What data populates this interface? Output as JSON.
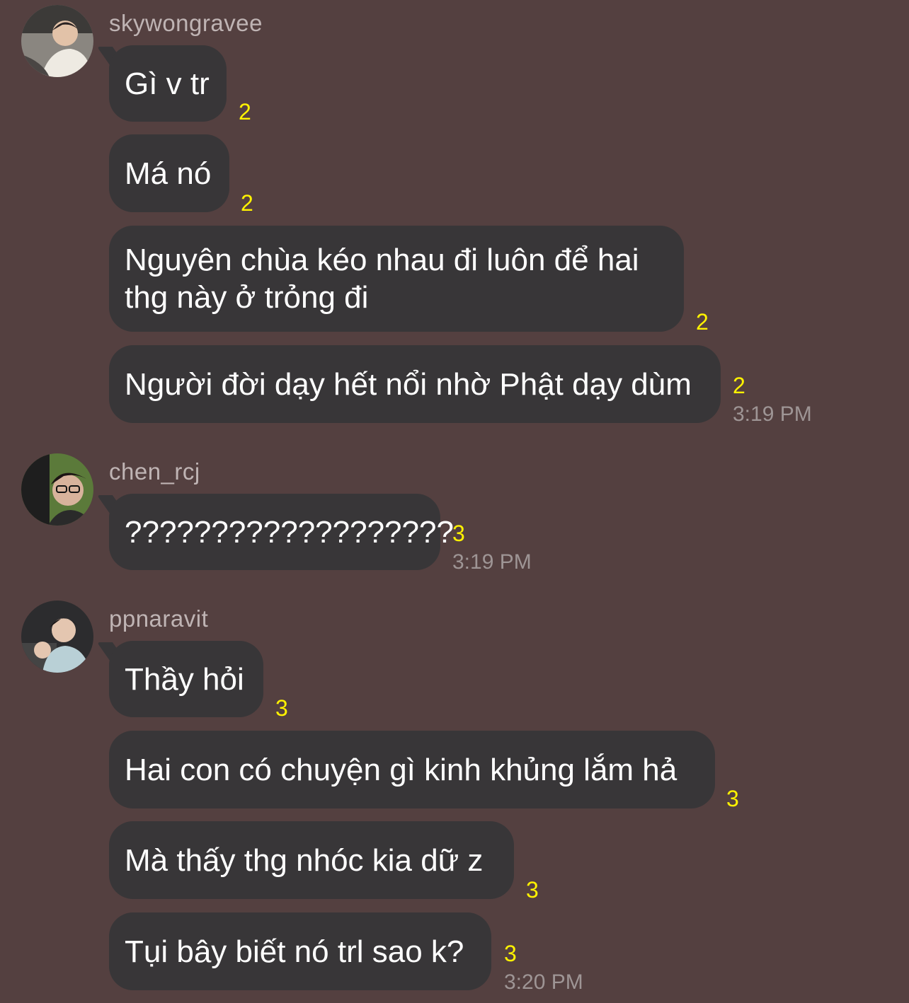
{
  "colors": {
    "background": "#544040",
    "bubble": "#383638",
    "text": "#ffffff",
    "sender": "#bfb4b4",
    "read_count": "#fff200",
    "timestamp": "#9e9595"
  },
  "groups": [
    {
      "sender": "skywongravee",
      "avatar_icon": "user-avatar-photo",
      "messages": [
        {
          "text": "Gì v tr",
          "read": "2"
        },
        {
          "text": "Má nó",
          "read": "2"
        },
        {
          "text": "Nguyên chùa kéo nhau đi luôn để hai thg này ở trỏng đi",
          "read": "2"
        },
        {
          "text": "Người đời dạy hết nổi nhờ Phật dạy dùm",
          "read": "2",
          "time": "3:19 PM"
        }
      ]
    },
    {
      "sender": "chen_rcj",
      "avatar_icon": "user-avatar-photo",
      "messages": [
        {
          "text": "???????????????????",
          "read": "3",
          "time": "3:19 PM"
        }
      ]
    },
    {
      "sender": "ppnaravit",
      "avatar_icon": "user-avatar-photo",
      "messages": [
        {
          "text": "Thầy hỏi",
          "read": "3"
        },
        {
          "text": "Hai con có chuyện gì kinh khủng lắm hả",
          "read": "3"
        },
        {
          "text": "Mà thấy thg nhóc kia dữ z",
          "read": "3"
        },
        {
          "text": "Tụi bây biết nó trl sao k?",
          "read": "3",
          "time": "3:20 PM"
        }
      ]
    }
  ]
}
